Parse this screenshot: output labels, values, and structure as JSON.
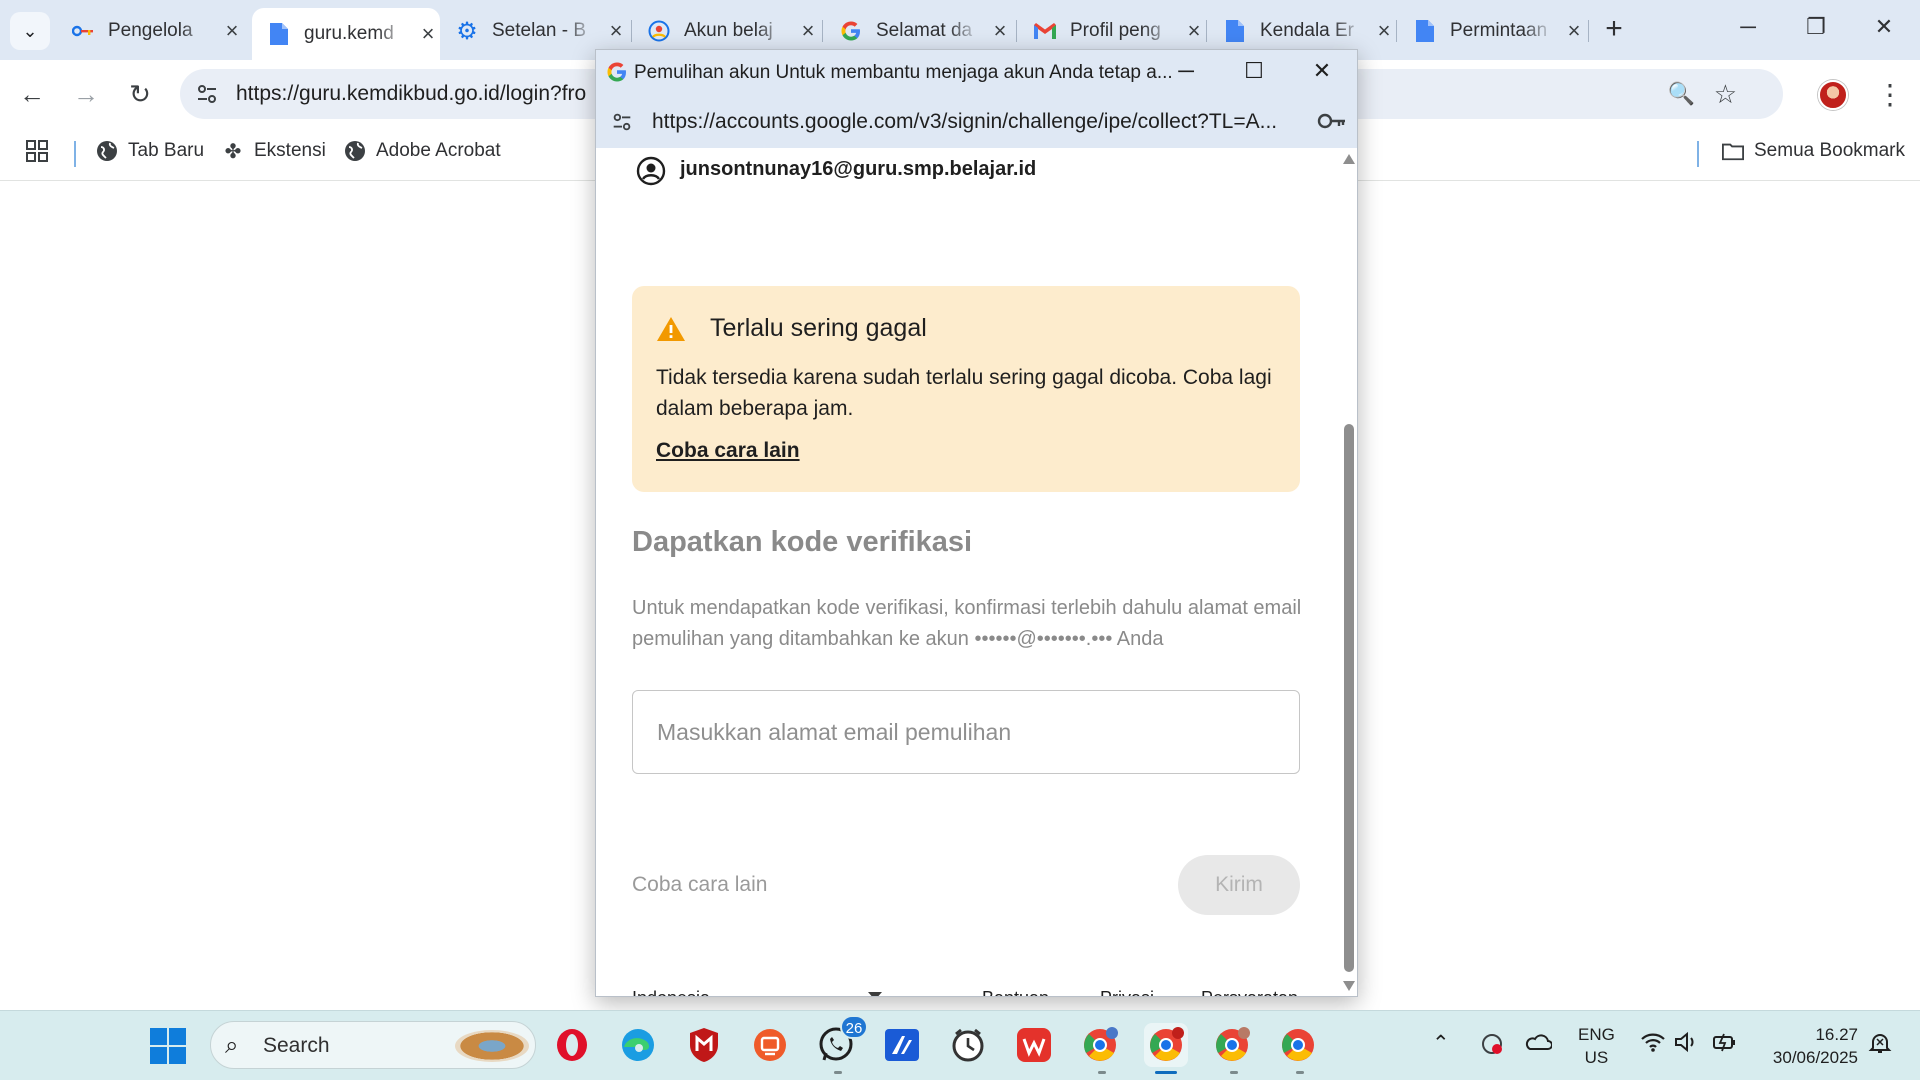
{
  "browser": {
    "tabs": [
      {
        "label": "Pengelola",
        "icon": "key-icon"
      },
      {
        "label": "guru.kemd",
        "icon": "doc-icon",
        "active": true
      },
      {
        "label": "Setelan - B",
        "icon": "gear-icon"
      },
      {
        "label": "Akun belaj",
        "icon": "google-account-icon"
      },
      {
        "label": "Selamat da",
        "icon": "google-icon"
      },
      {
        "label": "Profil peng",
        "icon": "gmail-icon"
      },
      {
        "label": "Kendala Er",
        "icon": "doc-icon"
      },
      {
        "label": "Permintaan",
        "icon": "doc-icon"
      }
    ],
    "url": "https://guru.kemdikbud.go.id/login?fro",
    "bookmarks": [
      {
        "label": "Tab Baru",
        "icon": "globe-icon"
      },
      {
        "label": "Ekstensi",
        "icon": "puzzle-icon"
      },
      {
        "label": "Adobe Acrobat",
        "icon": "globe-icon"
      }
    ],
    "all_bookmarks_label": "Semua Bookmark"
  },
  "popup": {
    "title": "Pemulihan akun Untuk membantu menjaga akun Anda tetap a...",
    "url": "https://accounts.google.com/v3/signin/challenge/ipe/collect?TL=A...",
    "account_email": "junsontnunay16@guru.smp.belajar.id",
    "alert": {
      "title": "Terlalu sering gagal",
      "text": "Tidak tersedia karena sudah terlalu sering gagal dicoba. Coba lagi dalam beberapa jam.",
      "link": "Coba cara lain"
    },
    "heading": "Dapatkan kode verifikasi",
    "description": "Untuk mendapatkan kode verifikasi, konfirmasi terlebih dahulu alamat email pemulihan yang ditambahkan ke akun ••••••@•••••••.••• Anda",
    "input_placeholder": "Masukkan alamat email pemulihan",
    "try_other": "Coba cara lain",
    "send_label": "Kirim",
    "language": "Indonesia",
    "footer_links": [
      "Bantuan",
      "Privasi",
      "Persyaratan"
    ]
  },
  "taskbar": {
    "search_label": "Search",
    "whatsapp_badge": "26",
    "lang_line1": "ENG",
    "lang_line2": "US",
    "time": "16.27",
    "date": "30/06/2025"
  },
  "colors": {
    "alert_bg": "#fdeccd",
    "warning_icon": "#f29900",
    "tabstrip_bg": "#dfe8f4",
    "taskbar_bg": "#d7ecee"
  }
}
